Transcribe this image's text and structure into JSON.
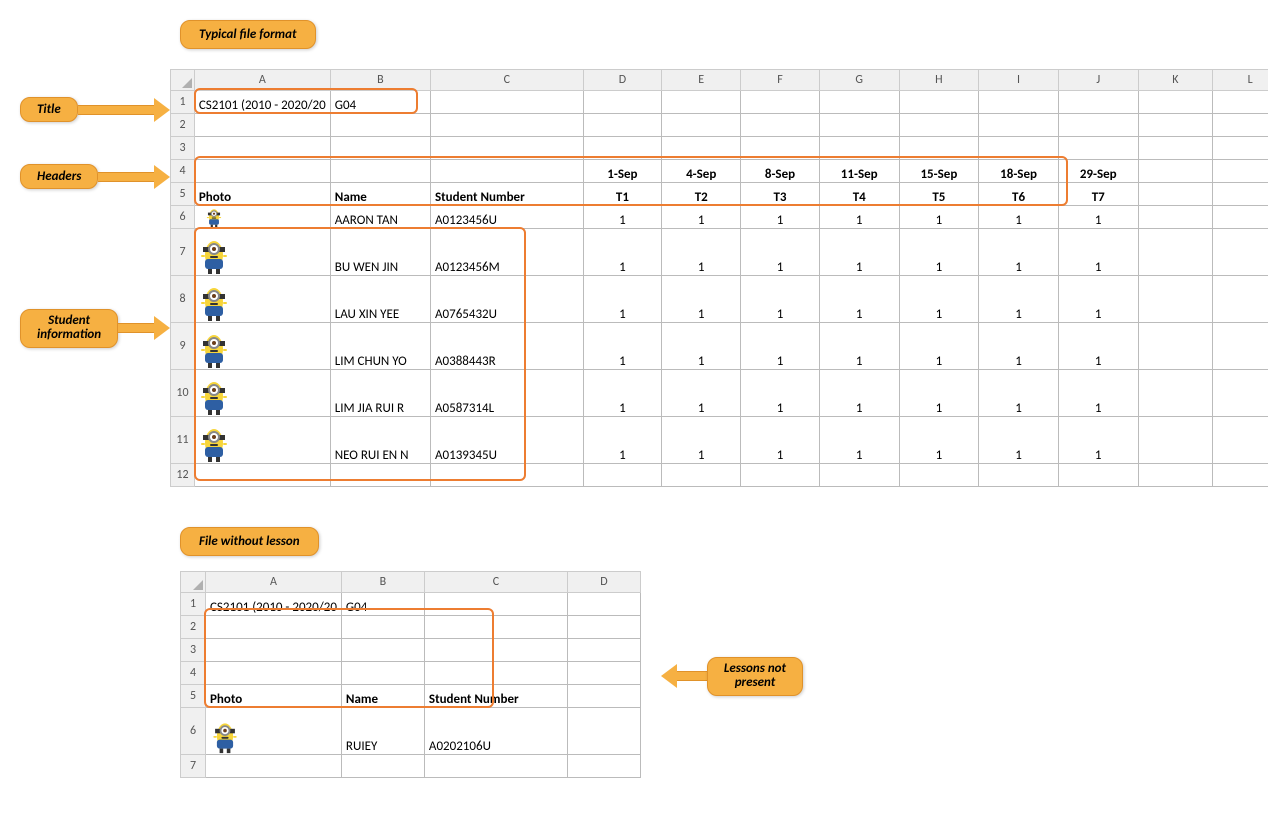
{
  "callouts": {
    "typical_format": "Typical file format",
    "title": "Title",
    "headers": "Headers",
    "student_info_l1": "Student",
    "student_info_l2": "information",
    "file_without_lesson": "File without lesson",
    "lessons_not_present_l1": "Lessons not",
    "lessons_not_present_l2": "present"
  },
  "sheet1": {
    "title": "CS2101 (2010 - 2020/20",
    "title_b": "G04",
    "cols": [
      "A",
      "B",
      "C",
      "D",
      "E",
      "F",
      "G",
      "H",
      "I",
      "J",
      "K",
      "L"
    ],
    "rows": [
      "1",
      "2",
      "3",
      "4",
      "5",
      "6",
      "7",
      "8",
      "9",
      "10",
      "11",
      "12"
    ],
    "dates": [
      "1-Sep",
      "4-Sep",
      "8-Sep",
      "11-Sep",
      "15-Sep",
      "18-Sep",
      "29-Sep"
    ],
    "headers": {
      "photo": "Photo",
      "name": "Name",
      "stuno": "Student Number"
    },
    "tnums": [
      "T1",
      "T2",
      "T3",
      "T4",
      "T5",
      "T6",
      "T7"
    ],
    "students": [
      {
        "name": "AARON TAN",
        "stuno": "A0123456U",
        "vals": [
          "1",
          "1",
          "1",
          "1",
          "1",
          "1",
          "1"
        ]
      },
      {
        "name": "BU WEN JIN",
        "stuno": "A0123456M",
        "vals": [
          "1",
          "1",
          "1",
          "1",
          "1",
          "1",
          "1"
        ]
      },
      {
        "name": "LAU XIN YEE",
        "stuno": "A0765432U",
        "vals": [
          "1",
          "1",
          "1",
          "1",
          "1",
          "1",
          "1"
        ]
      },
      {
        "name": "LIM CHUN YO",
        "stuno": "A0388443R",
        "vals": [
          "1",
          "1",
          "1",
          "1",
          "1",
          "1",
          "1"
        ]
      },
      {
        "name": "LIM JIA RUI R",
        "stuno": "A0587314L",
        "vals": [
          "1",
          "1",
          "1",
          "1",
          "1",
          "1",
          "1"
        ]
      },
      {
        "name": "NEO RUI EN N",
        "stuno": "A0139345U",
        "vals": [
          "1",
          "1",
          "1",
          "1",
          "1",
          "1",
          "1"
        ]
      }
    ]
  },
  "sheet2": {
    "title": "CS2101 (2010 - 2020/20",
    "title_b": "G04",
    "cols": [
      "A",
      "B",
      "C",
      "D"
    ],
    "rows": [
      "1",
      "2",
      "3",
      "4",
      "5",
      "6",
      "7"
    ],
    "headers": {
      "photo": "Photo",
      "name": "Name",
      "stuno": "Student Number"
    },
    "students": [
      {
        "name": "RUIEY",
        "stuno": "A0202106U"
      }
    ]
  }
}
